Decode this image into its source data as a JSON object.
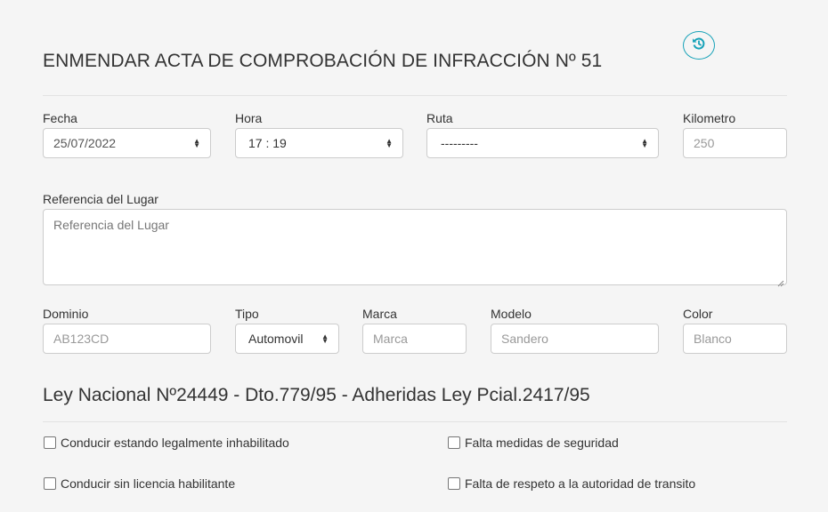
{
  "header": {
    "title": "ENMENDAR ACTA DE COMPROBACIÓN DE INFRACCIÓN Nº 51",
    "history_icon": "history-icon"
  },
  "form": {
    "fecha": {
      "label": "Fecha",
      "value": "25/07/2022"
    },
    "hora": {
      "label": "Hora",
      "value": "17 : 19"
    },
    "ruta": {
      "label": "Ruta",
      "value": "---------"
    },
    "kilometro": {
      "label": "Kilometro",
      "placeholder": "250"
    },
    "referencia": {
      "label": "Referencia del Lugar",
      "placeholder": "Referencia del Lugar"
    },
    "dominio": {
      "label": "Dominio",
      "placeholder": "AB123CD"
    },
    "tipo": {
      "label": "Tipo",
      "value": "Automovil"
    },
    "marca": {
      "label": "Marca",
      "placeholder": "Marca"
    },
    "modelo": {
      "label": "Modelo",
      "placeholder": "Sandero"
    },
    "color": {
      "label": "Color",
      "placeholder": "Blanco"
    }
  },
  "law_section": {
    "title": "Ley Nacional Nº24449 - Dto.779/95 - Adheridas Ley Pcial.2417/95",
    "infractions": [
      {
        "label": "Conducir estando legalmente inhabilitado",
        "checked": false
      },
      {
        "label": "Falta medidas de seguridad",
        "checked": false
      },
      {
        "label": "Conducir sin licencia habilitante",
        "checked": false
      },
      {
        "label": "Falta de respeto a la autoridad de transito",
        "checked": false
      }
    ]
  },
  "colors": {
    "accent": "#17a2b8",
    "border": "#cccccc",
    "background": "#f5f5f5"
  }
}
